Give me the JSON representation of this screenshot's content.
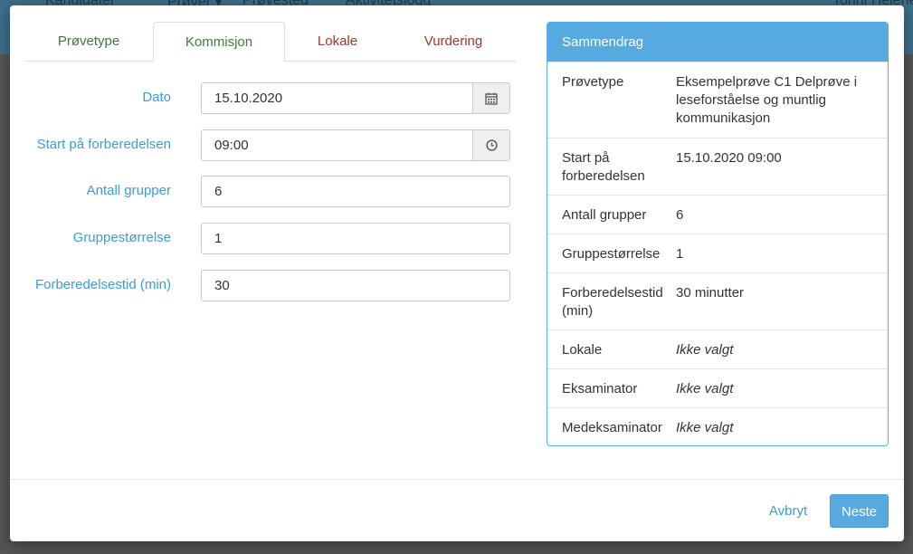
{
  "background_nav": {
    "items": [
      "Kandidater",
      "Prøver ▾",
      "Prøvested",
      "Aktivitetslogg",
      "Tonni Helene"
    ]
  },
  "tabs": [
    {
      "label": "Prøvetype",
      "state": "done"
    },
    {
      "label": "Kommisjon",
      "state": "active"
    },
    {
      "label": "Lokale",
      "state": "todo"
    },
    {
      "label": "Vurdering",
      "state": "todo"
    }
  ],
  "form": {
    "date": {
      "label": "Dato",
      "value": "15.10.2020",
      "icon": "calendar-icon"
    },
    "start": {
      "label": "Start på forberedelsen",
      "value": "09:00",
      "icon": "clock-icon"
    },
    "groups": {
      "label": "Antall grupper",
      "value": "6"
    },
    "group_size": {
      "label": "Gruppestørrelse",
      "value": "1"
    },
    "prep_time": {
      "label": "Forberedelsestid (min)",
      "value": "30"
    }
  },
  "summary": {
    "title": "Sammendrag",
    "rows": [
      {
        "key": "Prøvetype",
        "value": "Eksempelprøve C1 Delprøve i leseforståelse og muntlig kommunikasjon"
      },
      {
        "key": "Start på forberedelsen",
        "value": "15.10.2020 09:00"
      },
      {
        "key": "Antall grupper",
        "value": "6"
      },
      {
        "key": "Gruppestørrelse",
        "value": "1"
      },
      {
        "key": "Forberedelsestid (min)",
        "value": "30 minutter"
      },
      {
        "key": "Lokale",
        "value": "Ikke valgt"
      },
      {
        "key": "Eksaminator",
        "value": "Ikke valgt"
      },
      {
        "key": "Medeksaminator",
        "value": "Ikke valgt"
      }
    ]
  },
  "footer": {
    "cancel_label": "Avbryt",
    "next_label": "Neste"
  },
  "colors": {
    "accent": "#56aadf",
    "label_blue": "#3d9cd6",
    "tab_done": "#3c7a3c",
    "tab_todo": "#a4332b"
  }
}
